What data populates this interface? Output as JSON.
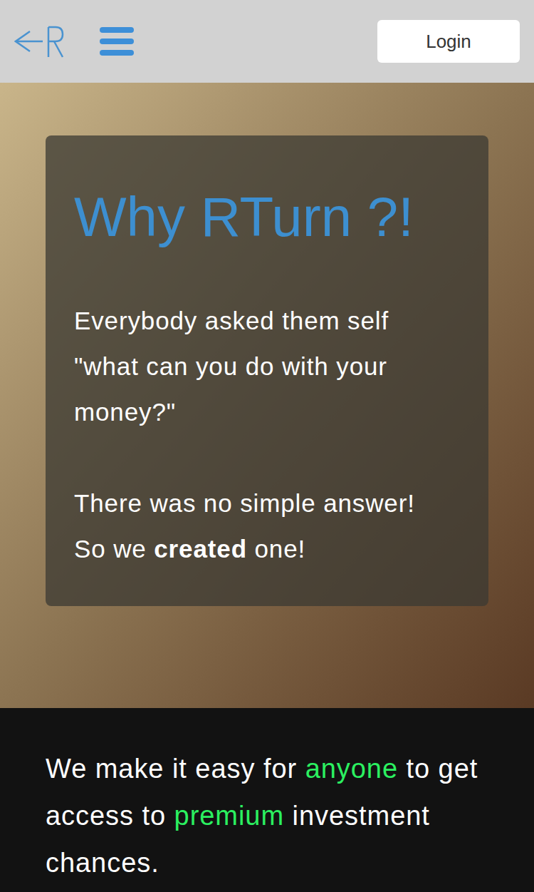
{
  "header": {
    "login": "Login"
  },
  "hero": {
    "title": "Why RTurn ?!",
    "paragraph1": "Everybody asked them self \"what can you do with your money?\"",
    "line2": "There was no simple answer!",
    "line3": [
      {
        "text": "So we ",
        "bold": false
      },
      {
        "text": "created",
        "bold": true
      },
      {
        "text": " one!",
        "bold": false
      }
    ]
  },
  "tagline": [
    {
      "text": "We make it easy for ",
      "highlight": false
    },
    {
      "text": "anyone",
      "highlight": true
    },
    {
      "text": " to get access to ",
      "highlight": false
    },
    {
      "text": "premium",
      "highlight": true
    },
    {
      "text": " investment chances.",
      "highlight": false
    }
  ]
}
